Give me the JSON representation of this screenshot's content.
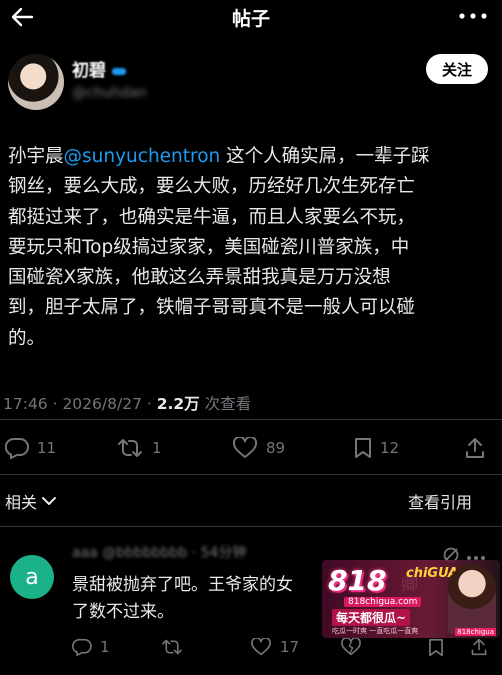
{
  "header": {
    "title": "帖子"
  },
  "author": {
    "name": "初碧",
    "handle": "@chuhdan",
    "follow_label": "关注"
  },
  "post": {
    "prefix": "孙宇晨",
    "mention": "@sunyuchentron",
    "line1_rest": " 这个人确实屌，一辈子踩",
    "line2": "钢丝，要么大成，要么大败，历经好几次生死存亡",
    "line3": "都挺过来了，也确实是牛逼，而且人家要么不玩，",
    "line4": "要玩只和Top级搞过家家，美国碰瓷川普家族，中",
    "line5": "国碰瓷X家族，他敢这么弄景甜我真是万万没想",
    "line6": "到，胆子太屌了，铁帽子哥哥真不是一般人可以碰",
    "line7": "的。"
  },
  "meta": {
    "time": "17:46 · 2026/8/27 · ",
    "views_count": "2.2万",
    "views_label": " 次查看"
  },
  "actions": {
    "replies": "11",
    "reposts": "1",
    "likes": "89",
    "bookmarks": "12"
  },
  "related": {
    "label": "相关",
    "quotes_label": "查看引用"
  },
  "reply": {
    "avatar_letter": "a",
    "meta": "aaa @bbbbbbbb · 54分钟",
    "line1": "景甜被抛弃了吧。王爷家的女",
    "line1_tail": "卿",
    "line2": "了数不过来。",
    "replies": "1",
    "likes": "17"
  },
  "watermark": {
    "logo": "818",
    "brand": "chiGUA",
    "url": "818chigua.com",
    "slogan": "每天都很瓜~",
    "tagline": "吃瓜一时爽 一直吃瓜一直爽",
    "badge": "818chigua"
  },
  "colors": {
    "background": "#000000",
    "text": "#e7e9ea",
    "muted": "#71767b",
    "link": "#1d9bf0",
    "reply_avatar": "#1bb28a"
  }
}
